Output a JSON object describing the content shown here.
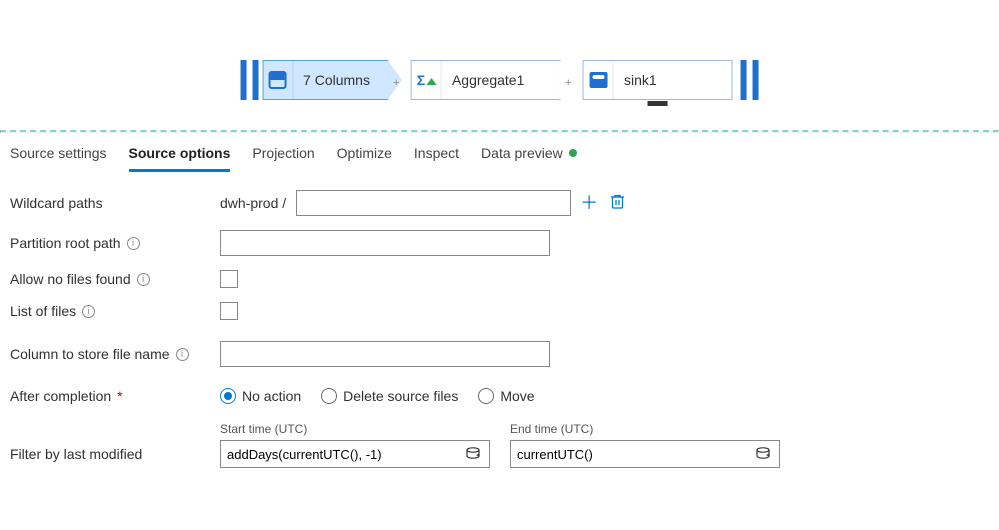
{
  "flow": {
    "source_label": "7 Columns",
    "aggregate_label": "Aggregate1",
    "sink_label": "sink1"
  },
  "tabs": {
    "source_settings": "Source settings",
    "source_options": "Source options",
    "projection": "Projection",
    "optimize": "Optimize",
    "inspect": "Inspect",
    "data_preview": "Data preview"
  },
  "labels": {
    "wildcard_paths": "Wildcard paths",
    "partition_root": "Partition root path",
    "allow_no_files": "Allow no files found",
    "list_of_files": "List of files",
    "column_store": "Column to store file name",
    "after_completion": "After completion",
    "filter_modified": "Filter by last modified",
    "start_time": "Start time (UTC)",
    "end_time": "End time (UTC)"
  },
  "values": {
    "wildcard_prefix": "dwh-prod  /",
    "wildcard_input": "",
    "partition_root": "",
    "column_store": "",
    "start_expr": "addDays(currentUTC(), -1)",
    "end_expr": "currentUTC()"
  },
  "radios": {
    "no_action": "No action",
    "delete_source": "Delete source files",
    "move": "Move"
  }
}
